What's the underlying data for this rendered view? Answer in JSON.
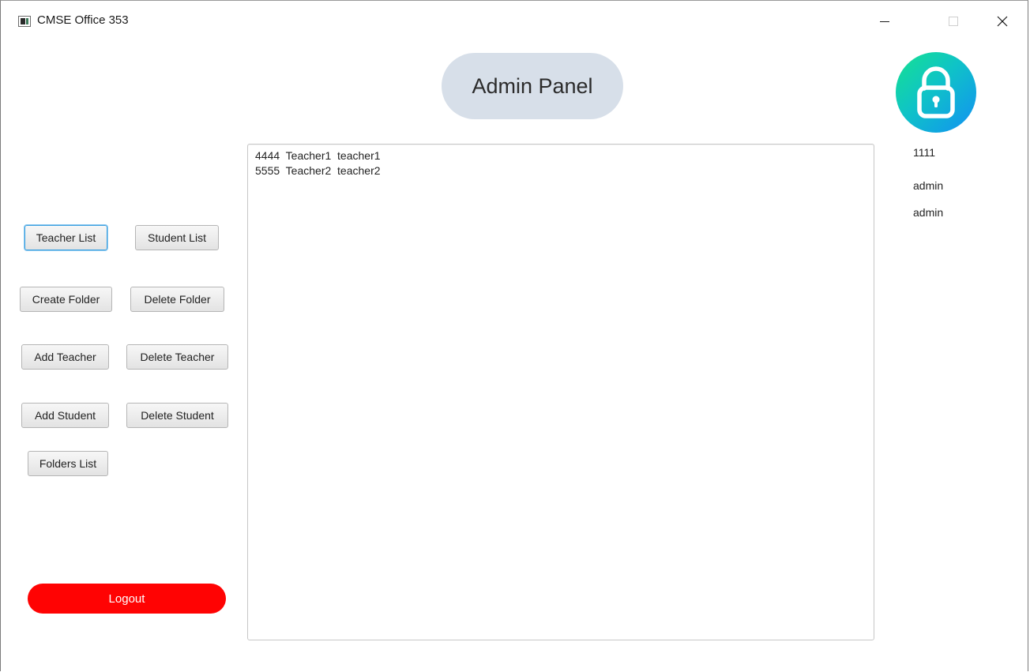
{
  "window": {
    "title": "CMSE Office 353",
    "controls": {
      "minimize_icon": "minimize-icon",
      "maximize_icon": "maximize-icon",
      "close_icon": "close-icon"
    }
  },
  "header": {
    "title": "Admin Panel",
    "pill_color": "#d7dfe9"
  },
  "lock": {
    "icon": "lock-icon",
    "gradient": [
      "#16e28f",
      "#0fc3c7",
      "#1290f3"
    ]
  },
  "user_info": {
    "id": "1111",
    "username": "admin",
    "role": "admin"
  },
  "list": {
    "lines": [
      "4444  Teacher1  teacher1",
      "5555  Teacher2  teacher2"
    ]
  },
  "buttons": {
    "teacher_list": "Teacher List",
    "student_list": "Student List",
    "create_folder": "Create Folder",
    "delete_folder": "Delete Folder",
    "add_teacher": "Add Teacher",
    "delete_teacher": "Delete Teacher",
    "add_student": "Add Student",
    "delete_student": "Delete Student",
    "folders_list": "Folders List",
    "logout": "Logout"
  },
  "colors": {
    "logout": "#ff0303",
    "focus_ring": "#3aa0e0"
  }
}
